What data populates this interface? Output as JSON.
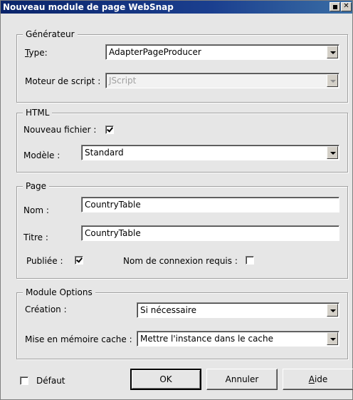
{
  "window": {
    "title": "Nouveau module de page WebSnap"
  },
  "generator": {
    "group_title": "Générateur",
    "type_label": "Type:",
    "type_mnemonic": "T",
    "type_rest": "ype:",
    "type_value": "AdapterPageProducer",
    "script_label": "Moteur de script :",
    "script_value": "JScript"
  },
  "html": {
    "group_title": "HTML",
    "new_file_label": "Nouveau fichier :",
    "new_file_checked": true,
    "template_label": "Modèle :",
    "template_value": "Standard"
  },
  "page": {
    "group_title": "Page",
    "name_label": "Nom :",
    "name_value": "CountryTable",
    "title_label": "Titre :",
    "title_value": "CountryTable",
    "published_label": "Publiée :",
    "published_checked": true,
    "login_label": "Nom de connexion requis :",
    "login_checked": false
  },
  "module_options": {
    "group_title": "Module Options",
    "creation_label": "Création :",
    "creation_value": "Si nécessaire",
    "cache_label": "Mise en mémoire cache :",
    "cache_value": "Mettre l'instance dans le cache"
  },
  "footer": {
    "default_label": "Défaut",
    "default_checked": false,
    "ok_label": "OK",
    "cancel_label": "Annuler",
    "help_label": "Aide",
    "help_mnemonic": "A",
    "help_rest": "ide"
  },
  "colors": {
    "titlebar": "#0a246a",
    "background": "#e6e6e6"
  }
}
